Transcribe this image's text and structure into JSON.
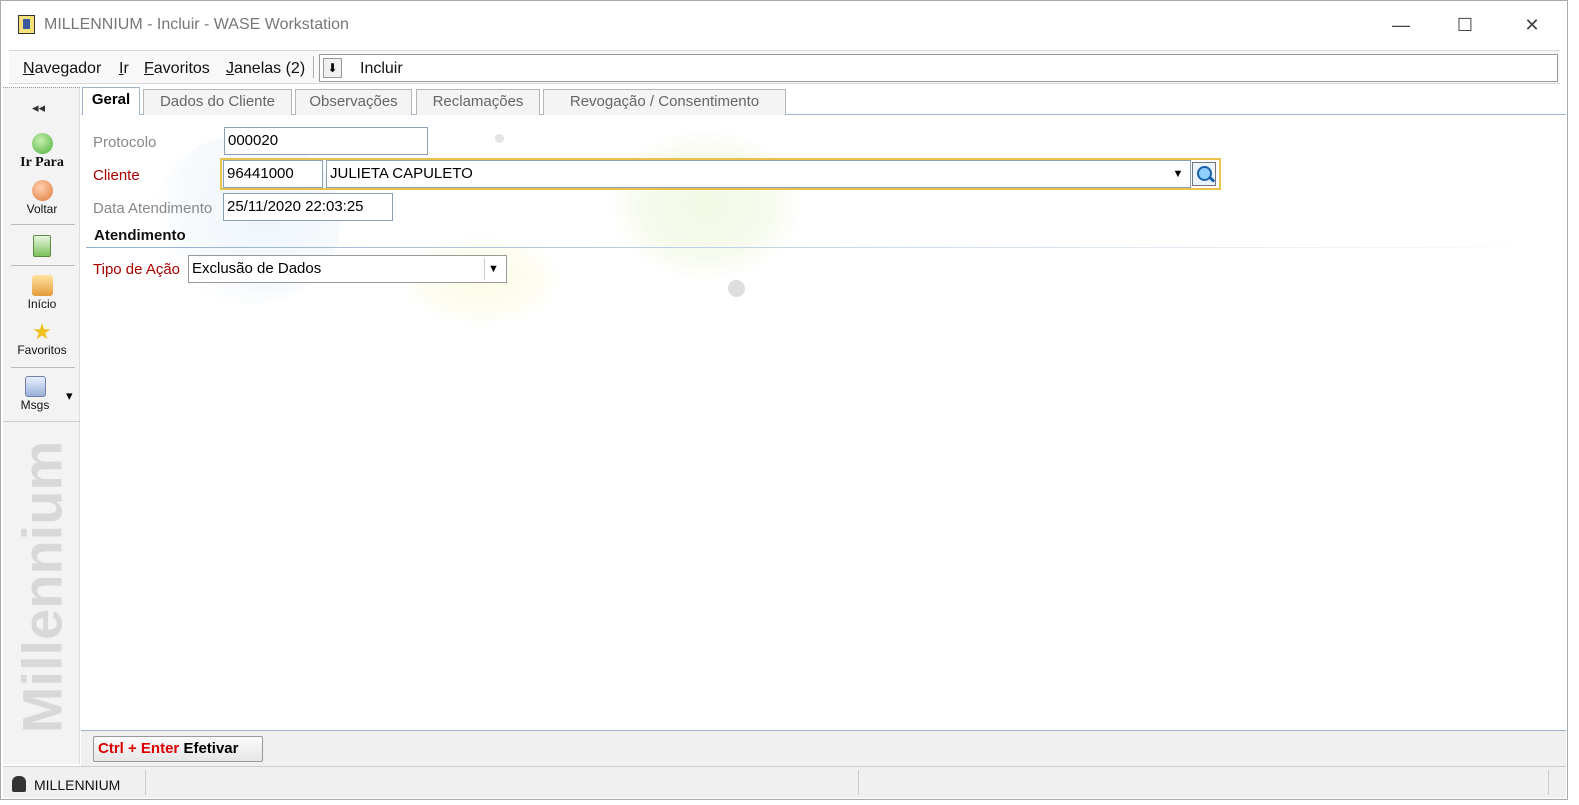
{
  "window": {
    "title": "MILLENNIUM - Incluir - WASE Workstation",
    "minimize_glyph": "—",
    "maximize_glyph": "☐",
    "close_glyph": "✕"
  },
  "menu": {
    "navegador": {
      "key": "N",
      "rest": "avegador"
    },
    "ir": {
      "key": "I",
      "rest": "r"
    },
    "favoritos": {
      "key": "F",
      "rest": "avoritos"
    },
    "janelas": {
      "key": "J",
      "rest": "anelas (2)"
    }
  },
  "address": {
    "arrow": "⬇",
    "text": "Incluir"
  },
  "sidebar": {
    "collapse": "◂◂",
    "ir_para": "Ir Para",
    "voltar": "Voltar",
    "inicio": "Início",
    "favoritos": "Favoritos",
    "msgs": "Msgs",
    "msgs_arrow": "▾",
    "brand": "Millennium"
  },
  "tabs": {
    "geral": "Geral",
    "dados_cliente": "Dados do Cliente",
    "observacoes": "Observações",
    "reclamacoes": "Reclamações",
    "revogacao": "Revogação / Consentimento"
  },
  "form": {
    "protocolo_label": "Protocolo",
    "protocolo_value": "000020",
    "cliente_label": "Cliente",
    "cliente_code": "96441000",
    "cliente_name": "JULIETA CAPULETO",
    "data_label": "Data Atendimento",
    "data_value": "25/11/2020 22:03:25",
    "section": "Atendimento",
    "tipo_label": "Tipo de Ação",
    "tipo_value": "Exclusão de Dados",
    "dropdown_glyph": "▼"
  },
  "footer": {
    "shortcut": "Ctrl + Enter",
    "action": "Efetivar"
  },
  "status": {
    "user": "MILLENNIUM"
  },
  "colors": {
    "accent_yellow": "#e8c24a",
    "label_red": "#aa0000",
    "tab_border": "#9fb6cf"
  }
}
